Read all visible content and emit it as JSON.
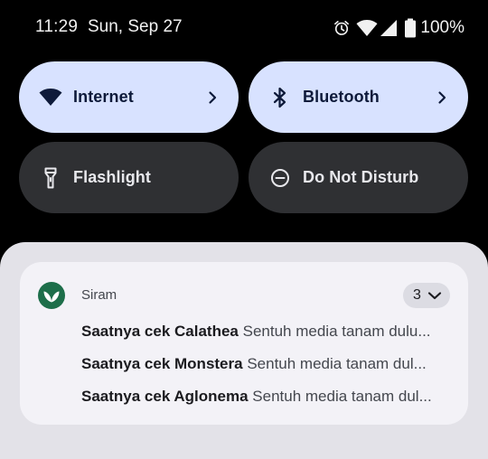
{
  "status_bar": {
    "time": "11:29",
    "date": "Sun, Sep 27",
    "icons": [
      "alarm-icon",
      "wifi-icon",
      "cellular-signal-icon",
      "battery-icon"
    ],
    "battery_percent": "100%"
  },
  "quick_settings": {
    "tiles": [
      {
        "label": "Internet",
        "icon": "wifi-icon",
        "state": "on",
        "has_chevron": true
      },
      {
        "label": "Bluetooth",
        "icon": "bluetooth-icon",
        "state": "on",
        "has_chevron": true
      },
      {
        "label": "Flashlight",
        "icon": "flashlight-icon",
        "state": "off",
        "has_chevron": false
      },
      {
        "label": "Do Not Disturb",
        "icon": "do-not-disturb-icon",
        "state": "off",
        "has_chevron": false
      }
    ]
  },
  "notification": {
    "app_name": "Siram",
    "app_icon": "leaf-icon",
    "count": "3",
    "items": [
      {
        "title": "Saatnya cek Calathea",
        "body": "Sentuh media tanam dulu..."
      },
      {
        "title": "Saatnya cek Monstera",
        "body": "Sentuh media tanam dul..."
      },
      {
        "title": "Saatnya cek Aglonema",
        "body": "Sentuh media tanam dul..."
      }
    ]
  },
  "colors": {
    "background": "#000000",
    "tile_on": "#d8e2ff",
    "tile_off": "#2f3033",
    "shade": "#e3e2e8",
    "card": "#f3f2f7",
    "app_accent": "#1d6e4a"
  }
}
